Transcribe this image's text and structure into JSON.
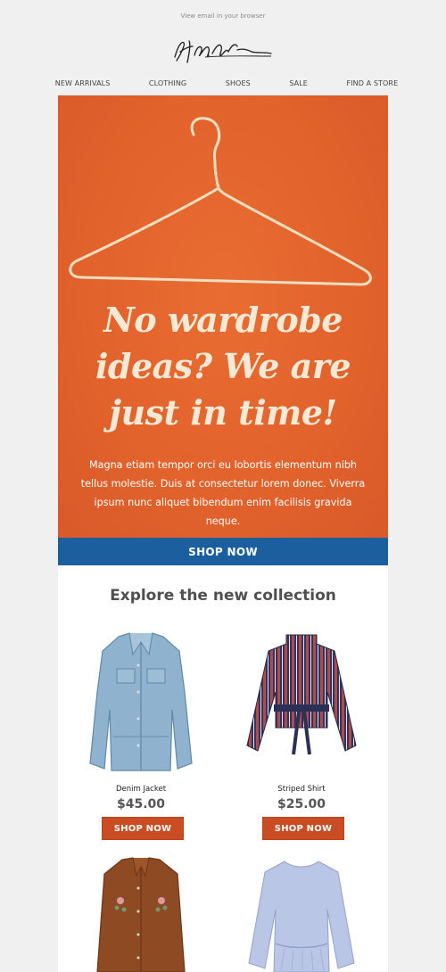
{
  "header": {
    "view_in_browser": "View email in your browser",
    "logo_alt": "signature-logo"
  },
  "nav": {
    "items": [
      "NEW ARRIVALS",
      "CLOTHING",
      "SHOES",
      "SALE",
      "FIND A STORE"
    ]
  },
  "hero": {
    "headline_lines": [
      "No wardrobe",
      "ideas? We are",
      "just in time!"
    ],
    "body": "Magna etiam tempor orci eu lobortis elementum nibh tellus molestie. Duis at consectetur lorem donec. Viverra ipsum nunc aliquet bibendum enim facilisis gravida neque.",
    "cta": "SHOP NOW",
    "bg_color": "#e2662f",
    "cta_color": "#1b5f9f"
  },
  "collection": {
    "title": "Explore the new collection",
    "products": [
      {
        "name": "Denim Jacket",
        "price": "$45.00",
        "button": "SHOP NOW"
      },
      {
        "name": "Striped Shirt",
        "price": "$25.00",
        "button": "SHOP NOW"
      }
    ],
    "button_color": "#c94c22"
  }
}
